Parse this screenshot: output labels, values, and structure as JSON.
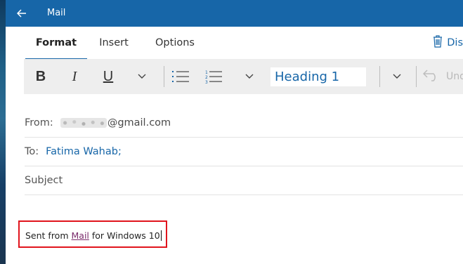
{
  "window": {
    "title": "Mail"
  },
  "tabs": [
    {
      "label": "Format",
      "active": true
    },
    {
      "label": "Insert",
      "active": false
    },
    {
      "label": "Options",
      "active": false
    }
  ],
  "discard_label": "Dis",
  "toolbar": {
    "bold": "B",
    "italic": "I",
    "underline": "U",
    "style_value": "Heading 1",
    "undo_label": "Und"
  },
  "compose": {
    "from_label": "From:",
    "from_value": "@gmail.com",
    "to_label": "To:",
    "to_value": "Fatima Wahab;",
    "subject_placeholder": "Subject"
  },
  "signature": {
    "prefix": "Sent from ",
    "link": "Mail",
    "suffix": " for Windows 10"
  },
  "colors": {
    "accent": "#1766a8",
    "highlight_border": "#e1141d",
    "toolbar_bg": "#eeeeee"
  }
}
